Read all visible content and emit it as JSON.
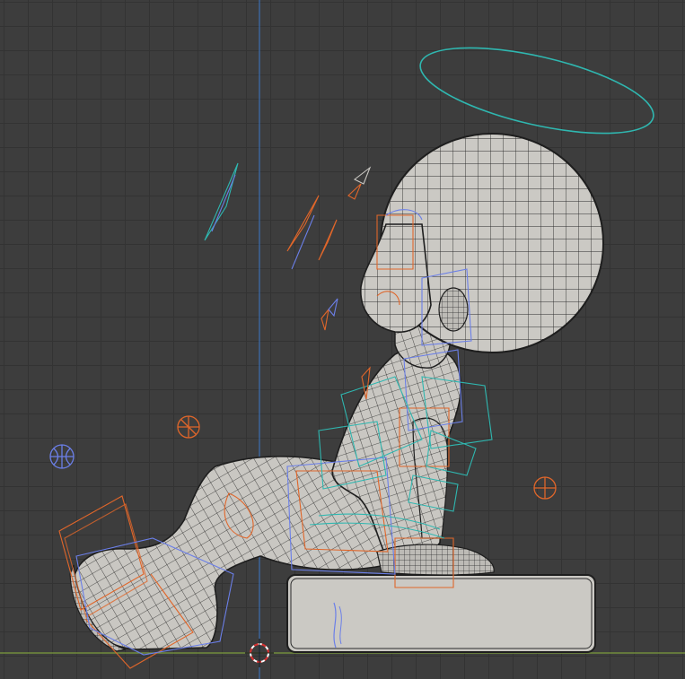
{
  "viewport": {
    "background": "#3d3d3d",
    "grid_color": "#333333",
    "x_axis_color": "#7d9b3c",
    "z_axis_color": "#3d6fb0"
  },
  "colors": {
    "mesh_fill": "#c9c7c2",
    "mesh_wire": "#2a2a2a",
    "armature_orange": "#e0662a",
    "armature_blue": "#6b7fe8",
    "halo_cyan": "#2fb7b0",
    "empty_orange": "#e0662a",
    "empty_blue": "#6b7fe8"
  },
  "objects": {
    "character": "character-mesh",
    "base": "base-block",
    "halo": "halo-ring",
    "cursor": "3d-cursor-icon"
  }
}
